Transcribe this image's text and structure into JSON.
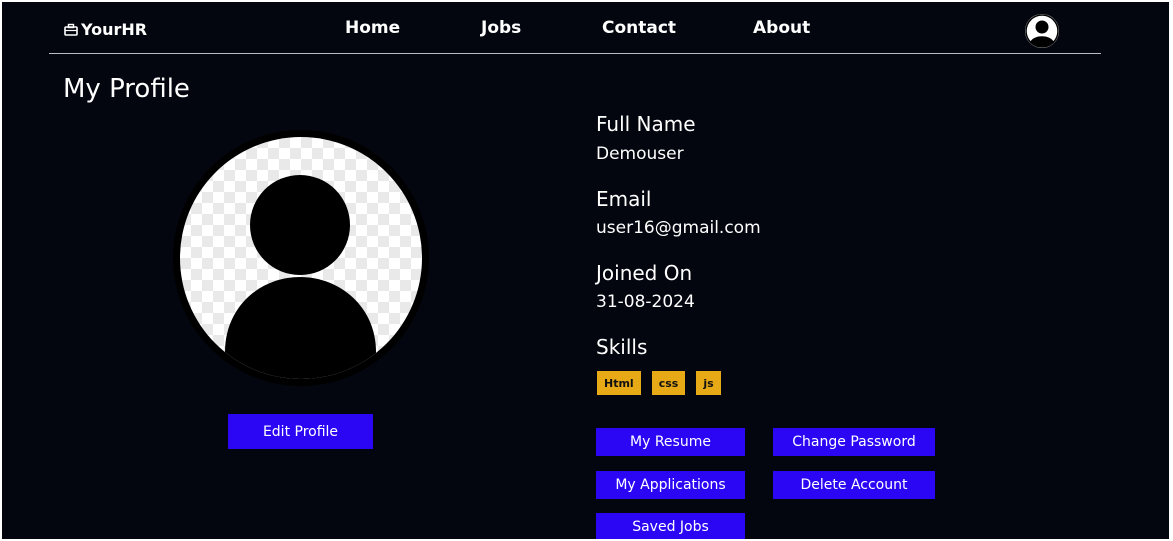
{
  "nav": {
    "brand": "YourHR",
    "links": {
      "home": "Home",
      "jobs": "Jobs",
      "contact": "Contact",
      "about": "About"
    }
  },
  "page": {
    "title": "My Profile"
  },
  "profile": {
    "edit_label": "Edit Profile",
    "fields": {
      "name_label": "Full Name",
      "name_value": "Demouser",
      "email_label": "Email",
      "email_value": "user16@gmail.com",
      "joined_label": "Joined On",
      "joined_value": "31-08-2024",
      "skills_label": "Skills"
    },
    "skills": [
      "Html",
      "css",
      "js"
    ]
  },
  "actions": {
    "resume": "My Resume",
    "change_password": "Change Password",
    "applications": "My Applications",
    "delete_account": "Delete Account",
    "saved_jobs": "Saved Jobs"
  },
  "colors": {
    "background": "#03060f",
    "button": "#2a06f5",
    "skill_tag": "#e8a917"
  },
  "icons": {
    "brand": "briefcase-icon",
    "nav_avatar": "user-avatar-icon",
    "profile_picture": "user-silhouette-icon"
  }
}
